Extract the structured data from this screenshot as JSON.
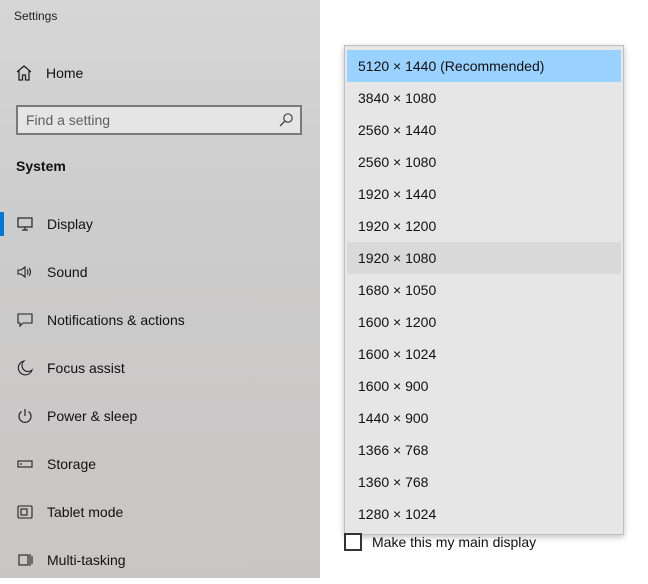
{
  "app_title": "Settings",
  "home_label": "Home",
  "search": {
    "placeholder": "Find a setting"
  },
  "section_label": "System",
  "nav_items": [
    {
      "label": "Display"
    },
    {
      "label": "Sound"
    },
    {
      "label": "Notifications & actions"
    },
    {
      "label": "Focus assist"
    },
    {
      "label": "Power & sleep"
    },
    {
      "label": "Storage"
    },
    {
      "label": "Tablet mode"
    },
    {
      "label": "Multi-tasking"
    }
  ],
  "resolution_options": [
    "5120 × 1440 (Recommended)",
    "3840 × 1080",
    "2560 × 1440",
    "2560 × 1080",
    "1920 × 1440",
    "1920 × 1200",
    "1920 × 1080",
    "1680 × 1050",
    "1600 × 1200",
    "1600 × 1024",
    "1600 × 900",
    "1440 × 900",
    "1366 × 768",
    "1360 × 768",
    "1280 × 1024"
  ],
  "main_display_checkbox": {
    "label": "Make this my main display",
    "checked": false
  },
  "colors": {
    "accent": "#0078d7",
    "selected_option": "#99d1ff"
  }
}
